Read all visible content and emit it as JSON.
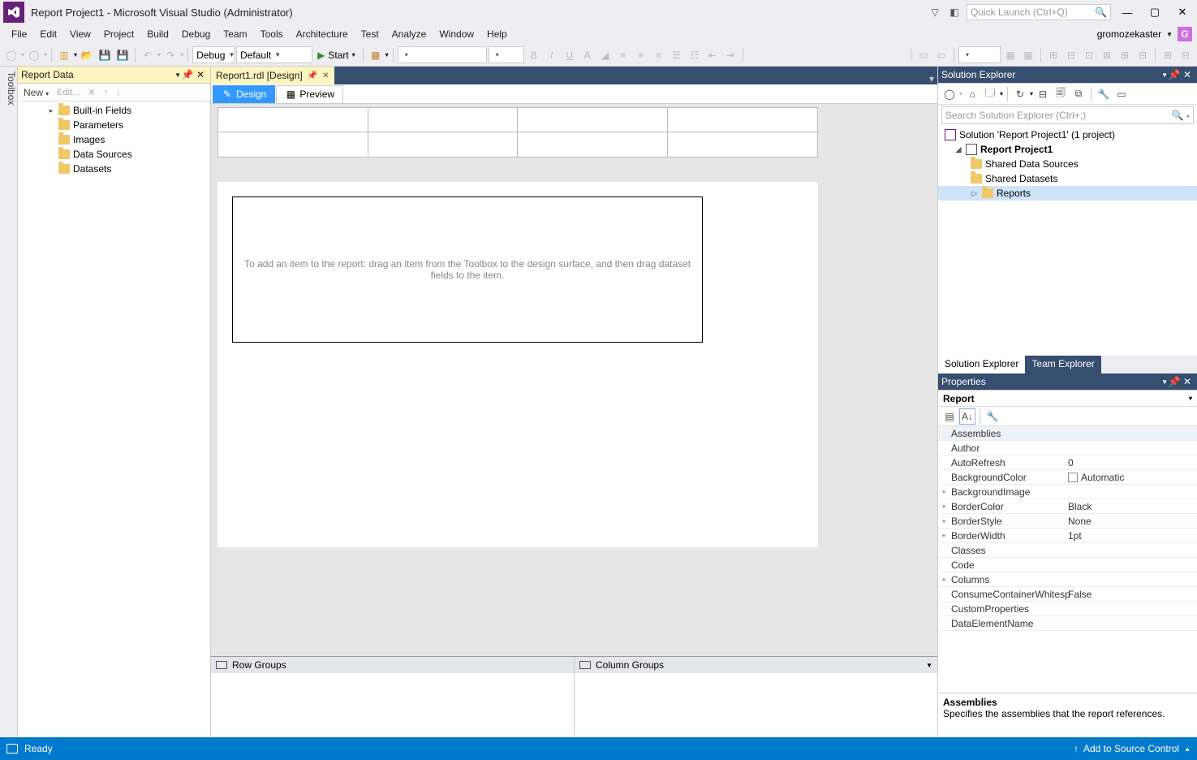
{
  "titlebar": {
    "title": "Report Project1 - Microsoft Visual Studio  (Administrator)",
    "quicklaunch_placeholder": "Quick Launch (Ctrl+Q)"
  },
  "menubar": {
    "items": [
      "File",
      "Edit",
      "View",
      "Project",
      "Build",
      "Debug",
      "Team",
      "Tools",
      "Architecture",
      "Test",
      "Analyze",
      "Window",
      "Help"
    ],
    "user": "gromozekaster",
    "user_initial": "G"
  },
  "toolbar": {
    "config": "Debug",
    "platform": "Default",
    "start_label": "Start"
  },
  "toolbox_strip": "Toolbox",
  "report_data": {
    "title": "Report Data",
    "toolbar": {
      "new": "New",
      "edit": "Edit..."
    },
    "items": [
      {
        "label": "Built-in Fields",
        "expander": "▸"
      },
      {
        "label": "Parameters"
      },
      {
        "label": "Images"
      },
      {
        "label": "Data Sources"
      },
      {
        "label": "Datasets"
      }
    ]
  },
  "doc_tab": {
    "label": "Report1.rdl [Design]"
  },
  "design_tabs": {
    "design": "Design",
    "preview": "Preview"
  },
  "canvas": {
    "placeholder": "To add an item to the report: drag an item from the Toolbox to the design surface, and then drag dataset fields to the item."
  },
  "groups": {
    "row": "Row Groups",
    "col": "Column Groups"
  },
  "solution_explorer": {
    "title": "Solution Explorer",
    "search_placeholder": "Search Solution Explorer (Ctrl+;)",
    "solution": "Solution 'Report Project1' (1 project)",
    "project": "Report Project1",
    "folders": [
      "Shared Data Sources",
      "Shared Datasets",
      "Reports"
    ],
    "tabs": {
      "se": "Solution Explorer",
      "te": "Team Explorer"
    }
  },
  "properties": {
    "title": "Properties",
    "object": "Report",
    "rows": [
      {
        "name": "Assemblies",
        "val": "",
        "sel": true
      },
      {
        "name": "Author",
        "val": ""
      },
      {
        "name": "AutoRefresh",
        "val": "0"
      },
      {
        "name": "BackgroundColor",
        "val": "Automatic",
        "color": true
      },
      {
        "name": "BackgroundImage",
        "val": "",
        "exp": "+"
      },
      {
        "name": "BorderColor",
        "val": "Black",
        "exp": "+"
      },
      {
        "name": "BorderStyle",
        "val": "None",
        "exp": "+"
      },
      {
        "name": "BorderWidth",
        "val": "1pt",
        "exp": "+"
      },
      {
        "name": "Classes",
        "val": ""
      },
      {
        "name": "Code",
        "val": ""
      },
      {
        "name": "Columns",
        "val": "",
        "exp": "+"
      },
      {
        "name": "ConsumeContainerWhitesp",
        "val": "False"
      },
      {
        "name": "CustomProperties",
        "val": ""
      },
      {
        "name": "DataElementName",
        "val": ""
      }
    ],
    "desc_name": "Assemblies",
    "desc_text": "Specifies the assemblies that the report references."
  },
  "statusbar": {
    "ready": "Ready",
    "source_control": "Add to Source Control"
  }
}
